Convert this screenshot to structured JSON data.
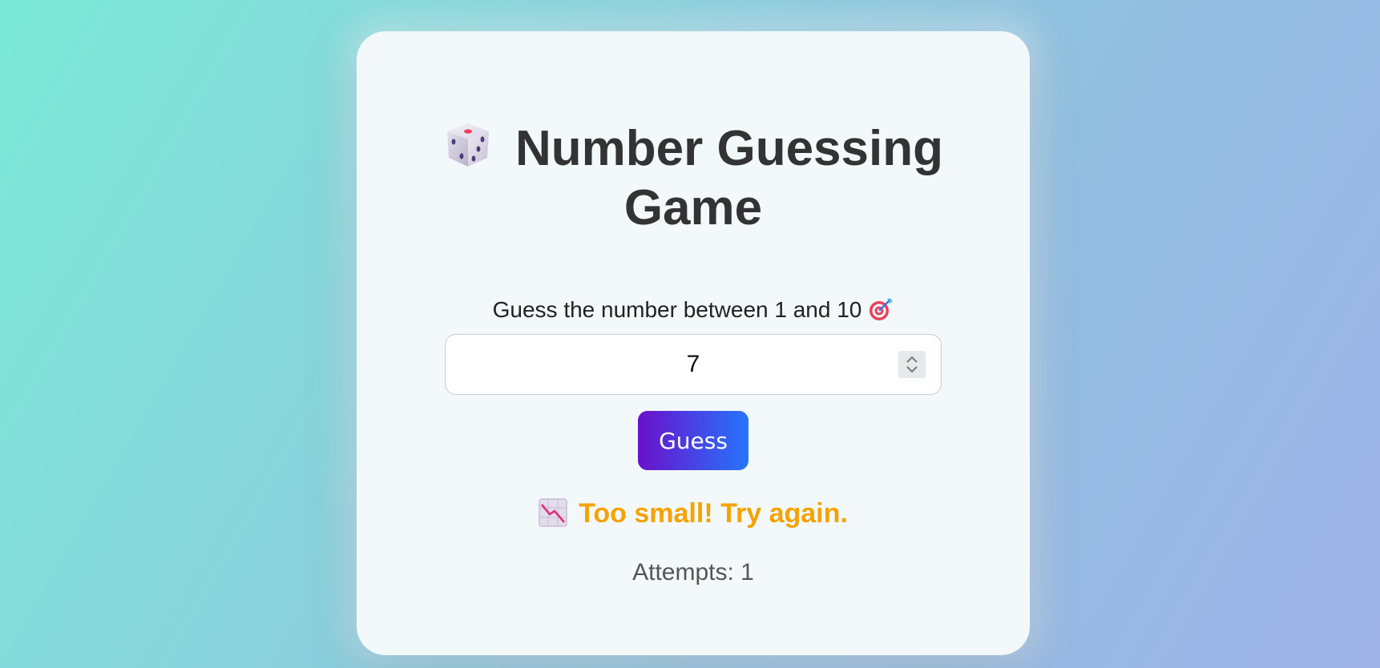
{
  "game": {
    "title": "Number Guessing Game",
    "title_icon": "dice-icon",
    "subtitle": "Guess the number between 1 and 10",
    "subtitle_icon": "target-icon",
    "input": {
      "value": "7",
      "min": "1",
      "max": "10"
    },
    "guess_button_label": "Guess",
    "feedback": {
      "icon": "chart-decreasing-icon",
      "text": "Too small! Try again.",
      "color": "#f5a300"
    },
    "attempts_label": "Attempts: 1"
  },
  "colors": {
    "button_gradient_start": "#6a11cb",
    "button_gradient_end": "#2575fc",
    "card_background": "#f3f8fa"
  }
}
